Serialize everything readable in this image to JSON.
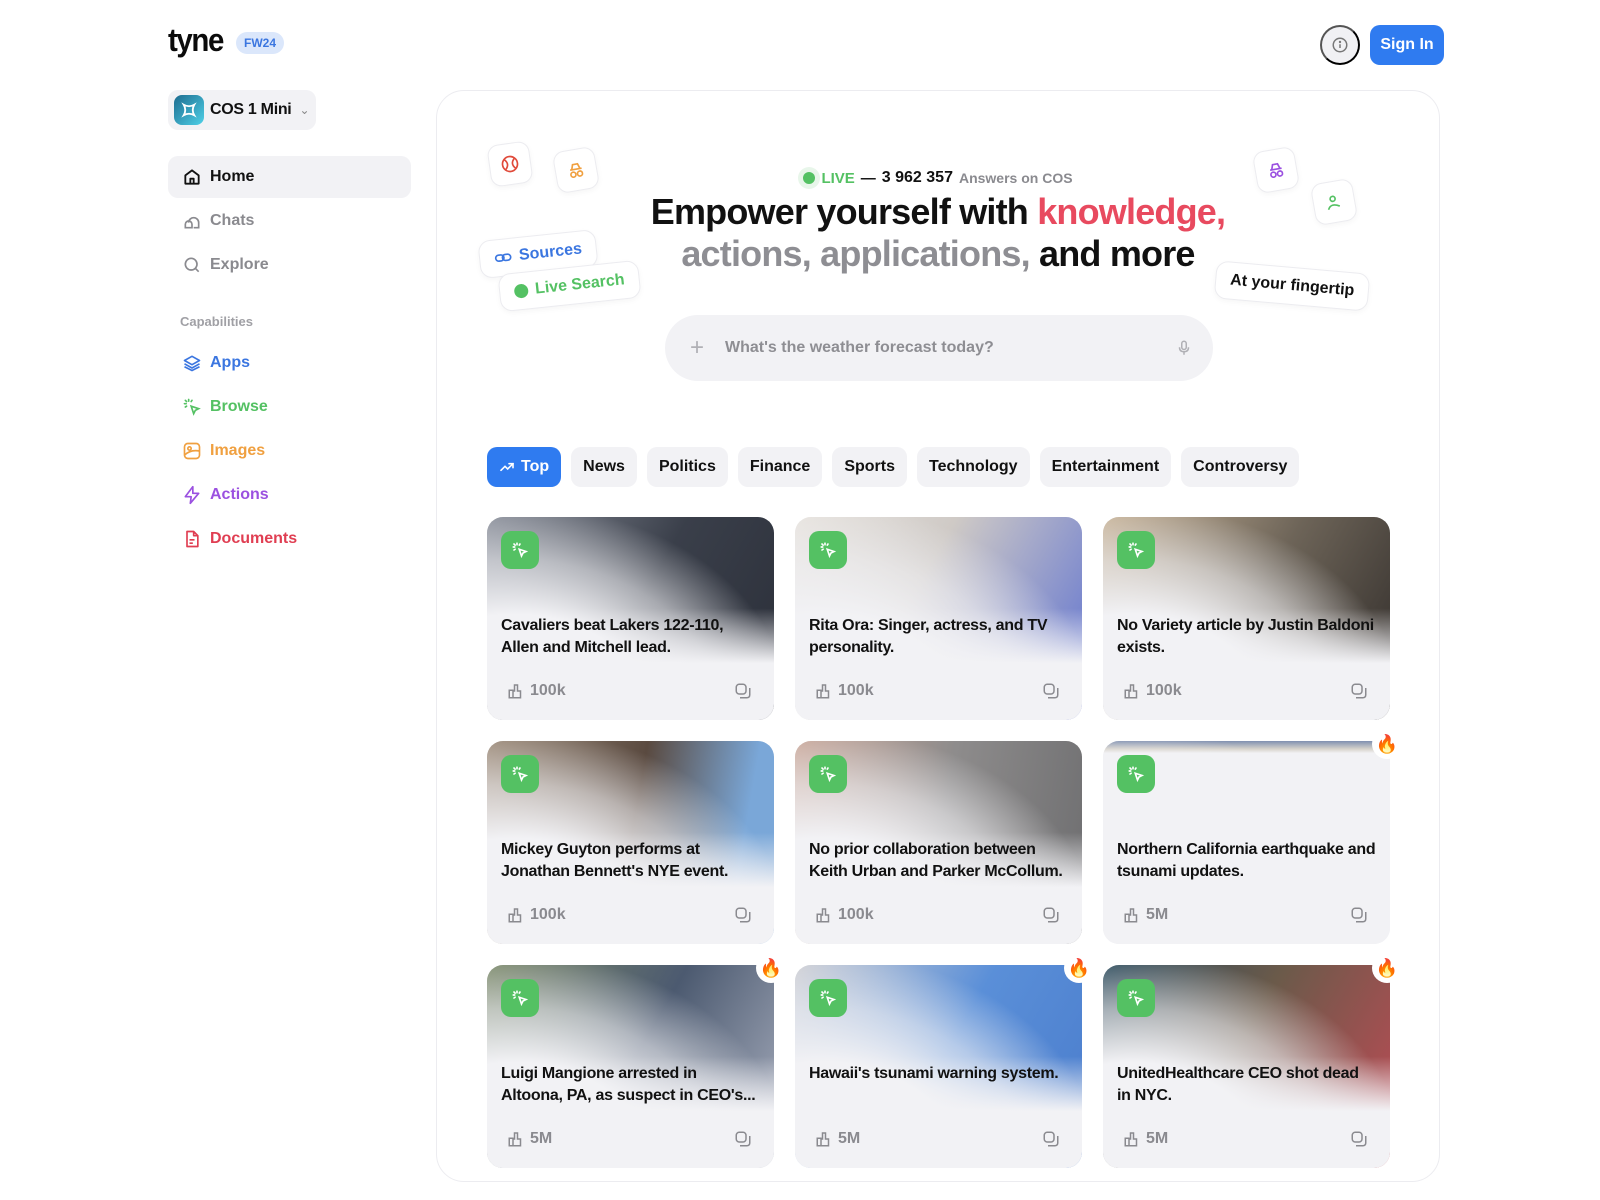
{
  "header": {
    "logo": "tyne",
    "badge": "FW24",
    "sign_in": "Sign In"
  },
  "sidebar": {
    "model": "COS 1 Mini",
    "nav": [
      {
        "label": "Home",
        "icon": "home-icon",
        "active": true
      },
      {
        "label": "Chats",
        "icon": "chat-icon"
      },
      {
        "label": "Explore",
        "icon": "search-icon"
      }
    ],
    "capabilities_label": "Capabilities",
    "capabilities": [
      {
        "label": "Apps",
        "icon": "layers-icon",
        "color": "#3b76e0"
      },
      {
        "label": "Browse",
        "icon": "cursor-click-icon",
        "color": "#54c163"
      },
      {
        "label": "Images",
        "icon": "image-icon",
        "color": "#f0a040"
      },
      {
        "label": "Actions",
        "icon": "lightning-icon",
        "color": "#9b51e0"
      },
      {
        "label": "Documents",
        "icon": "document-icon",
        "color": "#e03e52"
      }
    ]
  },
  "hero": {
    "live_label": "LIVE",
    "live_dash": "—",
    "live_count": "3 962 357",
    "live_suffix": "Answers on COS",
    "line1_a": "Empower yourself with ",
    "line1_b": "knowledge,",
    "line2_a": "actions, applications,",
    "line2_b": " and more",
    "chips": {
      "sources": "Sources",
      "live_search": "Live Search",
      "fingertip": "At your fingertip"
    }
  },
  "search": {
    "placeholder": "What's the weather forecast today?",
    "value": ""
  },
  "tabs": [
    {
      "label": "Top",
      "active": true
    },
    {
      "label": "News"
    },
    {
      "label": "Politics"
    },
    {
      "label": "Finance"
    },
    {
      "label": "Sports"
    },
    {
      "label": "Technology"
    },
    {
      "label": "Entertainment"
    },
    {
      "label": "Controversy"
    }
  ],
  "cards": [
    {
      "title": "Cavaliers beat Lakers 122-110, Allen and Mitchell lead.",
      "likes": "100k",
      "hot": false
    },
    {
      "title": "Rita Ora: Singer, actress, and TV personality.",
      "likes": "100k",
      "hot": false
    },
    {
      "title": "No Variety article by Justin Baldoni exists.",
      "likes": "100k",
      "hot": false
    },
    {
      "title": "Mickey Guyton performs at Jonathan Bennett's NYE event.",
      "likes": "100k",
      "hot": false
    },
    {
      "title": "No prior collaboration between Keith Urban and Parker McCollum.",
      "likes": "100k",
      "hot": false
    },
    {
      "title": "Northern California earthquake and tsunami updates.",
      "likes": "5M",
      "hot": true
    },
    {
      "title": "Luigi Mangione arrested in Altoona, PA, as suspect in CEO's...",
      "likes": "5M",
      "hot": true
    },
    {
      "title": "Hawaii's tsunami warning system.",
      "likes": "5M",
      "hot": true
    },
    {
      "title": "UnitedHealthcare CEO shot dead in NYC.",
      "likes": "5M",
      "hot": true
    }
  ],
  "colors": {
    "accent": "#2f7bf0",
    "live_green": "#54c163",
    "hero_red": "#e84a5f"
  }
}
